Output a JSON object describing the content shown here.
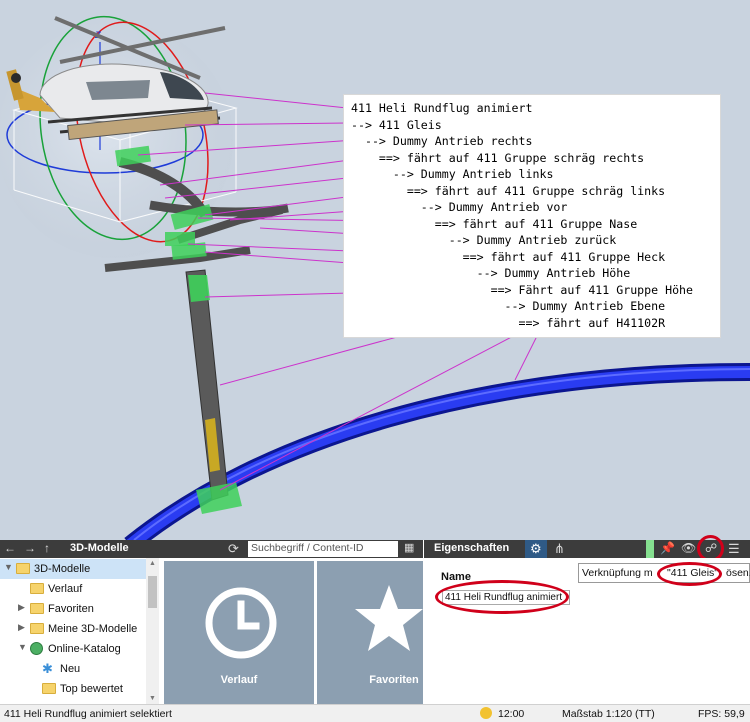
{
  "annotation": {
    "lines": [
      "411 Heli Rundflug animiert",
      "--> 411 Gleis",
      "  --> Dummy Antrieb rechts",
      "    ==> fährt auf 411 Gruppe schräg rechts",
      "      --> Dummy Antrieb links",
      "        ==> fährt auf 411 Gruppe schräg links",
      "          --> Dummy Antrieb vor",
      "            ==> fährt auf 411 Gruppe Nase",
      "              --> Dummy Antrieb zurück",
      "                ==> fährt auf 411 Gruppe Heck",
      "                  --> Dummy Antrieb Höhe",
      "                    ==> Fährt auf 411 Gruppe Höhe",
      "                      --> Dummy Antrieb Ebene",
      "                        ==> fährt auf H41102R"
    ]
  },
  "models_panel": {
    "title": "3D-Modelle",
    "search_placeholder": "Suchbegriff / Content-ID",
    "tree": [
      {
        "label": "3D-Modelle",
        "icon": "folder-icon",
        "arrow": "expanded"
      },
      {
        "label": "Verlauf",
        "icon": "folder-icon",
        "arrow": "none"
      },
      {
        "label": "Favoriten",
        "icon": "favorites-folder-icon",
        "arrow": "collapsed"
      },
      {
        "label": "Meine 3D-Modelle",
        "icon": "folder-icon",
        "arrow": "collapsed"
      },
      {
        "label": "Online-Katalog",
        "icon": "globe-icon",
        "arrow": "expanded"
      },
      {
        "label": "Neu",
        "icon": "star-burst-icon",
        "arrow": "none"
      },
      {
        "label": "Top bewertet",
        "icon": "top-rated-icon",
        "arrow": "none"
      }
    ],
    "tiles": [
      {
        "label": "Verlauf",
        "icon": "clock-icon"
      },
      {
        "label": "Favoriten",
        "icon": "star-icon"
      }
    ]
  },
  "properties_panel": {
    "title": "Eigenschaften",
    "name_label": "Name",
    "name_value": "411 Heli Rundflug animiert",
    "tooltip": {
      "prefix": "Verknüpfung m",
      "highlight": "\"411 Gleis\"",
      "suffix": "ösen."
    }
  },
  "status_bar": {
    "selection": "411 Heli Rundflug animiert selektiert",
    "time": "12:00",
    "scale": "Maßstab 1:120 (TT)",
    "fps": "FPS: 59,9"
  },
  "colors": {
    "viewport_bg": "#c9d3df",
    "panel_bar": "#3c3c3c",
    "tile_bg": "#8c9fb1",
    "highlight_ring": "#d0001a",
    "connector_line": "#cc33cc",
    "track_blue": "#1a2ad0"
  }
}
